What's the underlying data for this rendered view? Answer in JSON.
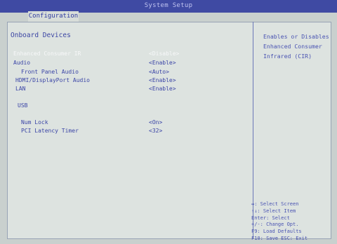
{
  "header": {
    "title": "System Setup",
    "tab": "Configuration"
  },
  "section": "Onboard Devices",
  "settings": [
    {
      "label": "Enhanced Consumer IR",
      "value": "<Disable>"
    },
    {
      "label": "Audio",
      "value": "<Enable>"
    },
    {
      "label": "Front Panel Audio",
      "value": "<Auto>"
    },
    {
      "label": "HDMI/DisplayPort Audio",
      "value": "<Enable>"
    },
    {
      "label": "LAN",
      "value": "<Enable>"
    },
    {
      "label": "USB"
    },
    {
      "label": "Num Lock",
      "value": "<On>"
    },
    {
      "label": "PCI Latency Timer",
      "value": "<32>"
    }
  ],
  "help_text": [
    "Enables or Disables",
    "Enhanced Consumer",
    "Infrared (CIR)"
  ],
  "key_hints": [
    "↔: Select Screen",
    "↑↓: Select Item",
    "Enter: Select",
    "+/-: Change Opt.",
    "F9: Load Defaults",
    "F10: Save  ESC: Exit"
  ],
  "colors": {
    "title_bar": "#3f4aa3",
    "background": "#dde3e0",
    "text": "#3a44a6",
    "highlight": "#f7f8f9"
  }
}
